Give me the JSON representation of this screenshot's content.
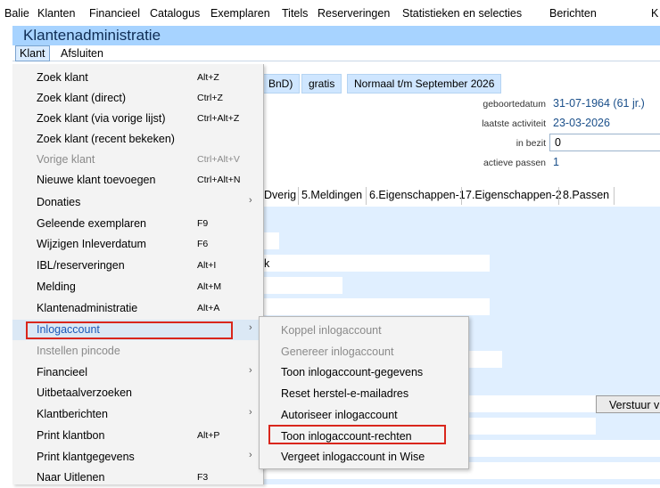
{
  "app_menu": [
    "Balie",
    "Klanten",
    "Financieel",
    "Catalogus",
    "Exemplaren",
    "Titels",
    "Reserveringen",
    "Statistieken en selecties",
    "Berichten",
    "K"
  ],
  "window": {
    "title": "Klantenadministratie",
    "menu": [
      "Klant",
      "Afsluiten"
    ]
  },
  "status": {
    "pill1": "BnD)",
    "pill2": "gratis",
    "pill3": "Normaal t/m September 2026"
  },
  "fields": {
    "geboortedatum_label": "geboortedatum",
    "geboortedatum_value": "31-07-1964 (61 jr.)",
    "laatste_activiteit_label": "laatste activiteit",
    "laatste_activiteit_value": "23-03-2026",
    "in_bezit_label": "in bezit",
    "in_bezit_value": "0",
    "actieve_passen_label": "actieve passen",
    "actieve_passen_value": "1"
  },
  "tabs": [
    "Dverig",
    "5.Meldingen",
    "6.Eigenschappen-1",
    "7.Eigenschappen-2",
    "8.Passen"
  ],
  "form": {
    "partial_text": "k",
    "verstuur_label": "Verstuur v"
  },
  "klant_menu": [
    {
      "label": "Zoek klant",
      "shortcut": "Alt+Z",
      "disabled": false,
      "submenu": false
    },
    {
      "label": "Zoek klant (direct)",
      "shortcut": "Ctrl+Z",
      "disabled": false,
      "submenu": false
    },
    {
      "label": "Zoek klant (via vorige lijst)",
      "shortcut": "Ctrl+Alt+Z",
      "disabled": false,
      "submenu": false
    },
    {
      "label": "Zoek klant (recent bekeken)",
      "shortcut": "",
      "disabled": false,
      "submenu": false
    },
    {
      "label": "Vorige klant",
      "shortcut": "Ctrl+Alt+V",
      "disabled": true,
      "submenu": false
    },
    {
      "label": "Nieuwe klant toevoegen",
      "shortcut": "Ctrl+Alt+N",
      "disabled": false,
      "submenu": false
    },
    {
      "label": "Donaties",
      "shortcut": "",
      "disabled": false,
      "submenu": true
    },
    {
      "label": "Geleende exemplaren",
      "shortcut": "F9",
      "disabled": false,
      "submenu": false
    },
    {
      "label": "Wijzigen Inleverdatum",
      "shortcut": "F6",
      "disabled": false,
      "submenu": false
    },
    {
      "label": "IBL/reserveringen",
      "shortcut": "Alt+I",
      "disabled": false,
      "submenu": false
    },
    {
      "label": "Melding",
      "shortcut": "Alt+M",
      "disabled": false,
      "submenu": false
    },
    {
      "label": "Klantenadministratie",
      "shortcut": "Alt+A",
      "disabled": false,
      "submenu": false
    },
    {
      "label": "Inlogaccount",
      "shortcut": "",
      "disabled": false,
      "submenu": true
    },
    {
      "label": "Instellen pincode",
      "shortcut": "",
      "disabled": true,
      "submenu": false
    },
    {
      "label": "Financieel",
      "shortcut": "",
      "disabled": false,
      "submenu": true
    },
    {
      "label": "Uitbetaalverzoeken",
      "shortcut": "",
      "disabled": false,
      "submenu": false
    },
    {
      "label": "Klantberichten",
      "shortcut": "",
      "disabled": false,
      "submenu": true
    },
    {
      "label": "Print klantbon",
      "shortcut": "Alt+P",
      "disabled": false,
      "submenu": false
    },
    {
      "label": "Print klantgegevens",
      "shortcut": "",
      "disabled": false,
      "submenu": true
    },
    {
      "label": "Naar Uitlenen",
      "shortcut": "F3",
      "disabled": false,
      "submenu": false
    }
  ],
  "inlog_submenu": [
    {
      "label": "Koppel inlogaccount",
      "disabled": true
    },
    {
      "label": "Genereer inlogaccount",
      "disabled": true
    },
    {
      "label": "Toon inlogaccount-gegevens",
      "disabled": false
    },
    {
      "label": "Reset herstel-e-mailadres",
      "disabled": false
    },
    {
      "label": "Autoriseer inlogaccount",
      "disabled": false
    },
    {
      "label": "Toon inlogaccount-rechten",
      "disabled": false
    },
    {
      "label": "Vergeet inlogaccount in Wise",
      "disabled": false
    }
  ],
  "icons": {
    "submenu_arrow": "chevron-right-icon"
  },
  "colors": {
    "title_bar": "#a7d3ff",
    "form_bg": "#e0efff",
    "highlight_border": "#d9261c",
    "active_item_text": "#1a58b8"
  }
}
